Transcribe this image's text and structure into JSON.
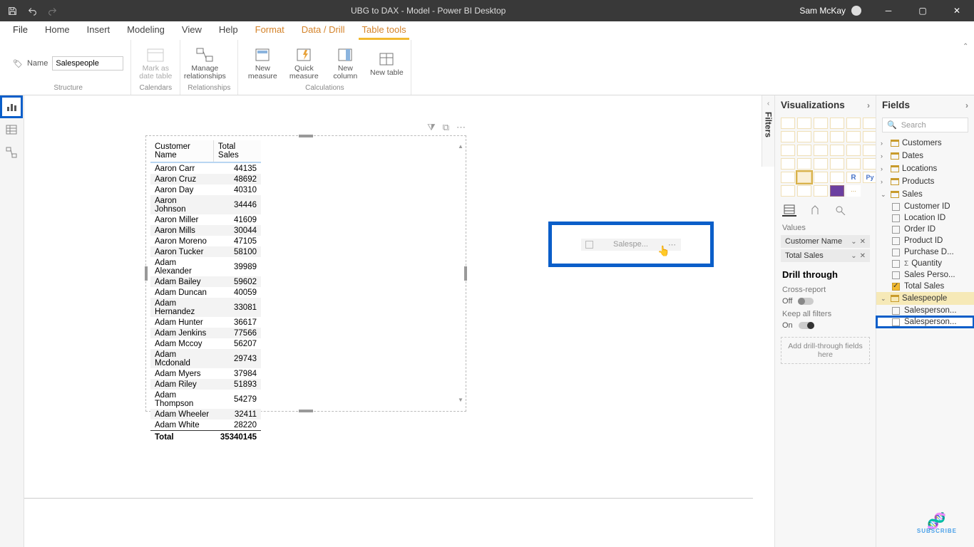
{
  "titlebar": {
    "title": "UBG to DAX - Model - Power BI Desktop",
    "user": "Sam McKay"
  },
  "menu": {
    "tabs": [
      "File",
      "Home",
      "Insert",
      "Modeling",
      "View",
      "Help",
      "Format",
      "Data / Drill",
      "Table tools"
    ]
  },
  "ribbon": {
    "name_label": "Name",
    "name_value": "Salespeople",
    "groups": {
      "structure": "Structure",
      "calendars": "Calendars",
      "relationships": "Relationships",
      "calculations": "Calculations"
    },
    "buttons": {
      "mark_date": "Mark as date table",
      "manage_rel": "Manage relationships",
      "new_measure": "New measure",
      "quick_measure": "Quick measure",
      "new_column": "New column",
      "new_table": "New table"
    }
  },
  "table_visual": {
    "headers": [
      "Customer Name",
      "Total Sales"
    ],
    "rows": [
      [
        "Aaron Carr",
        "44135"
      ],
      [
        "Aaron Cruz",
        "48692"
      ],
      [
        "Aaron Day",
        "40310"
      ],
      [
        "Aaron Johnson",
        "34446"
      ],
      [
        "Aaron Miller",
        "41609"
      ],
      [
        "Aaron Mills",
        "30044"
      ],
      [
        "Aaron Moreno",
        "47105"
      ],
      [
        "Aaron Tucker",
        "58100"
      ],
      [
        "Adam Alexander",
        "39989"
      ],
      [
        "Adam Bailey",
        "59602"
      ],
      [
        "Adam Duncan",
        "40059"
      ],
      [
        "Adam Hernandez",
        "33081"
      ],
      [
        "Adam Hunter",
        "36617"
      ],
      [
        "Adam Jenkins",
        "77566"
      ],
      [
        "Adam Mccoy",
        "56207"
      ],
      [
        "Adam Mcdonald",
        "29743"
      ],
      [
        "Adam Myers",
        "37984"
      ],
      [
        "Adam Riley",
        "51893"
      ],
      [
        "Adam Thompson",
        "54279"
      ],
      [
        "Adam Wheeler",
        "32411"
      ],
      [
        "Adam White",
        "28220"
      ]
    ],
    "total_label": "Total",
    "total_value": "35340145"
  },
  "slicer": {
    "placeholder": "Salespe..."
  },
  "vizpanel": {
    "title": "Visualizations",
    "values_label": "Values",
    "wells": [
      {
        "label": "Customer Name"
      },
      {
        "label": "Total Sales"
      }
    ],
    "drill_title": "Drill through",
    "cross_report": "Cross-report",
    "off": "Off",
    "keep_filters": "Keep all filters",
    "on": "On",
    "dropzone": "Add drill-through fields here"
  },
  "filters_tab": "Filters",
  "fieldspanel": {
    "title": "Fields",
    "search": "Search",
    "tables": [
      {
        "name": "Customers",
        "expanded": false
      },
      {
        "name": "Dates",
        "expanded": false
      },
      {
        "name": "Locations",
        "expanded": false
      },
      {
        "name": "Products",
        "expanded": false
      },
      {
        "name": "Sales",
        "expanded": true,
        "fields": [
          {
            "name": "Customer ID",
            "checked": false
          },
          {
            "name": "Location ID",
            "checked": false
          },
          {
            "name": "Order ID",
            "checked": false
          },
          {
            "name": "Product ID",
            "checked": false
          },
          {
            "name": "Purchase D...",
            "checked": false
          },
          {
            "name": "Quantity",
            "checked": false,
            "sigma": true
          },
          {
            "name": "Sales Perso...",
            "checked": false
          },
          {
            "name": "Total Sales",
            "checked": true
          }
        ]
      },
      {
        "name": "Salespeople",
        "expanded": true,
        "selected": true,
        "fields": [
          {
            "name": "Salesperson...",
            "checked": false
          },
          {
            "name": "Salesperson...",
            "checked": false,
            "highlighted": true
          }
        ]
      }
    ]
  },
  "subscribe": "SUBSCRIBE"
}
